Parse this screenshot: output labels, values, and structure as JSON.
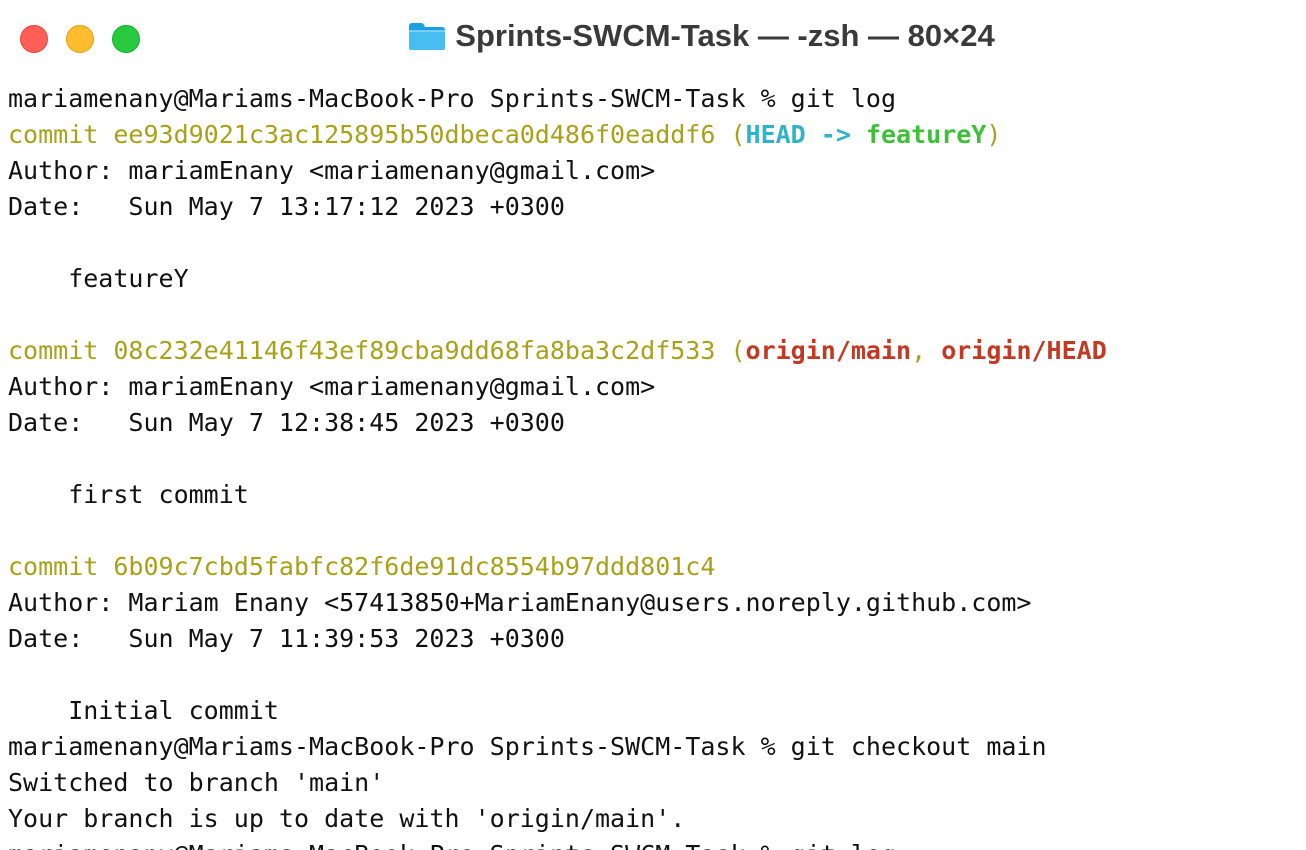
{
  "window": {
    "title": "Sprints-SWCM-Task — -zsh — 80×24",
    "folder_icon": "folder-icon",
    "colors": {
      "close": "#ff5f57",
      "minimize": "#febc2e",
      "zoom": "#28c840"
    }
  },
  "terminal": {
    "prompt1": "mariamenany@Mariams-MacBook-Pro Sprints-SWCM-Task % git log",
    "c1_prefix": "commit ee93d9021c3ac125895b50dbeca0d486f0eaddf6 (",
    "c1_head": "HEAD -> ",
    "c1_branch": "featureY",
    "c1_suffix": ")",
    "c1_author": "Author: mariamEnany <mariamenany@gmail.com>",
    "c1_date": "Date:   Sun May 7 13:17:12 2023 +0300",
    "c1_msg": "    featureY",
    "c2_prefix": "commit 08c232e41146f43ef89cba9dd68fa8ba3c2df533 (",
    "c2_ref1": "origin/main",
    "c2_sep": ", ",
    "c2_ref2": "origin/HEAD",
    "c2_author": "Author: mariamEnany <mariamenany@gmail.com>",
    "c2_date": "Date:   Sun May 7 12:38:45 2023 +0300",
    "c2_msg": "    first commit",
    "c3_commit": "commit 6b09c7cbd5fabfc82f6de91dc8554b97ddd801c4",
    "c3_author": "Author: Mariam Enany <57413850+MariamEnany@users.noreply.github.com>",
    "c3_date": "Date:   Sun May 7 11:39:53 2023 +0300",
    "c3_msg": "    Initial commit",
    "prompt2": "mariamenany@Mariams-MacBook-Pro Sprints-SWCM-Task % git checkout main",
    "switched": "Switched to branch 'main'",
    "uptodate": "Your branch is up to date with 'origin/main'.",
    "prompt3": "mariamenany@Mariams-MacBook-Pro Sprints-SWCM-Task % git log"
  }
}
